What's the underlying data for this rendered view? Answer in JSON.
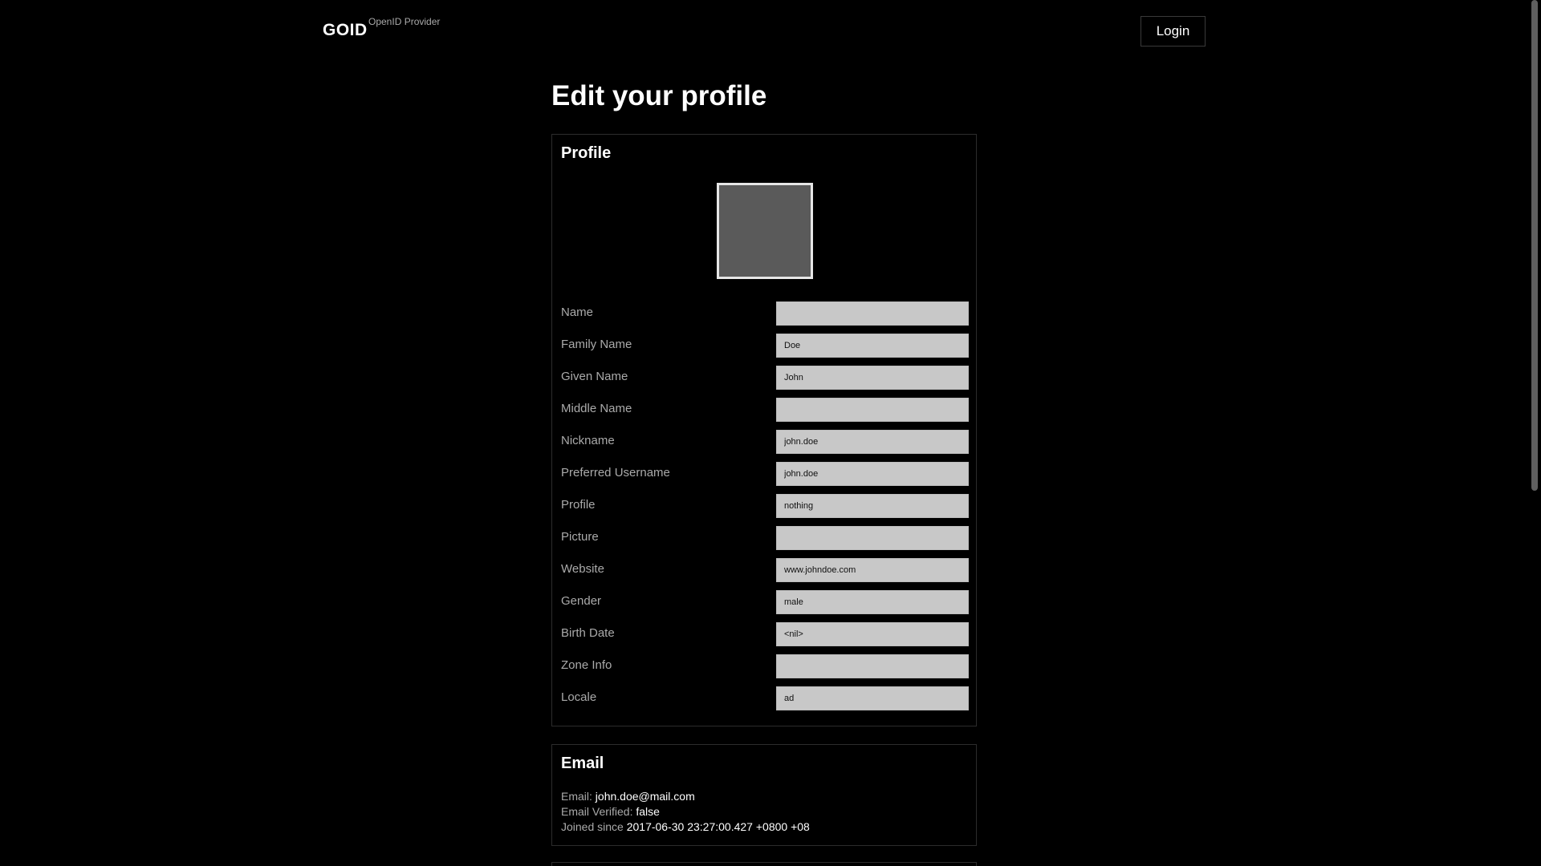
{
  "header": {
    "brand": "GOID",
    "brand_sub": "OpenID Provider",
    "login_label": "Login"
  },
  "page_title": "Edit your profile",
  "profile": {
    "section_title": "Profile",
    "fields": [
      {
        "label": "Name",
        "value": ""
      },
      {
        "label": "Family Name",
        "value": "Doe"
      },
      {
        "label": "Given Name",
        "value": "John"
      },
      {
        "label": "Middle Name",
        "value": ""
      },
      {
        "label": "Nickname",
        "value": "john.doe"
      },
      {
        "label": "Preferred Username",
        "value": "john.doe"
      },
      {
        "label": "Profile",
        "value": "nothing"
      },
      {
        "label": "Picture",
        "value": ""
      },
      {
        "label": "Website",
        "value": "www.johndoe.com"
      },
      {
        "label": "Gender",
        "value": "male"
      },
      {
        "label": "Birth Date",
        "value": "<nil>"
      },
      {
        "label": "Zone Info",
        "value": ""
      },
      {
        "label": "Locale",
        "value": "ad"
      }
    ]
  },
  "email": {
    "section_title": "Email",
    "email_label": "Email:",
    "email_value": "john.doe@mail.com",
    "verified_label": "Email Verified:",
    "verified_value": "false",
    "joined_label": "Joined since",
    "joined_value": "2017-06-30 23:27:00.427 +0800 +08"
  }
}
